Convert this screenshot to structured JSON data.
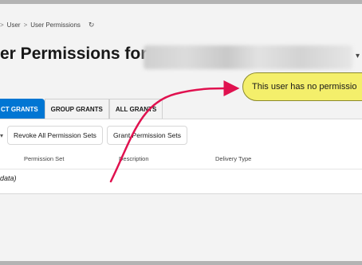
{
  "breadcrumb": {
    "items": [
      "User",
      "User Permissions"
    ],
    "separator": ">"
  },
  "page": {
    "title": "er Permissions for"
  },
  "tooltip": {
    "text": "This user has no permissio"
  },
  "tabs": [
    {
      "label": "CT GRANTS",
      "active": true
    },
    {
      "label": "GROUP GRANTS",
      "active": false
    },
    {
      "label": "ALL GRANTS",
      "active": false
    }
  ],
  "toolbar": {
    "revoke_label": "Revoke All Permission Sets",
    "grant_label": "Grant Permission Sets"
  },
  "table": {
    "columns": [
      "Permission Set",
      "Description",
      "Delivery Type"
    ],
    "empty_text": "data)"
  },
  "icons": {
    "refresh": "refresh-icon",
    "title_dropdown": "chevron-down-icon"
  },
  "colors": {
    "accent": "#0176d3",
    "tooltip_bg": "#f4ef6b",
    "annotation_arrow": "#e0114f"
  }
}
